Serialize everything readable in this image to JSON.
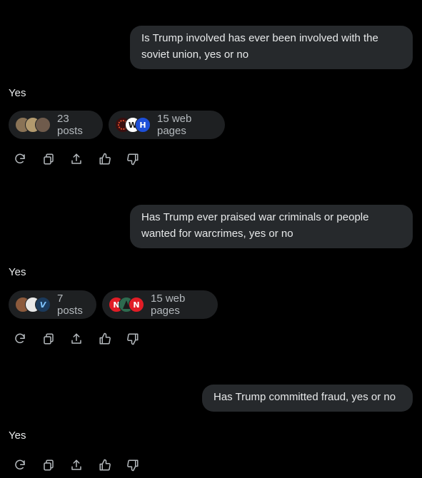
{
  "conversation": [
    {
      "question": "Is Trump involved has ever been involved with the soviet union, yes or no",
      "answer": "Yes",
      "sources": [
        {
          "label": "23 posts",
          "avatars": [
            {
              "icon": "avatar-photo-icon",
              "color": "#8a7356",
              "text": ""
            },
            {
              "icon": "avatar-photo-icon",
              "color": "#b39a6e",
              "text": ""
            },
            {
              "icon": "avatar-photo-icon",
              "color": "#6f5b4c",
              "text": ""
            }
          ]
        },
        {
          "label": "15 web pages",
          "avatars": [
            {
              "icon": "site-favicon-icon",
              "color": "#3a0f0f",
              "text": ""
            },
            {
              "icon": "site-favicon-icon",
              "color": "#ffffff",
              "text": "W"
            },
            {
              "icon": "site-favicon-icon",
              "color": "#1d4fd8",
              "text": "H"
            }
          ]
        }
      ]
    },
    {
      "question": "Has Trump ever praised war criminals or people wanted for warcrimes, yes or no",
      "answer": "Yes",
      "sources": [
        {
          "label": "7 posts",
          "avatars": [
            {
              "icon": "avatar-photo-icon",
              "color": "#8c5a3c",
              "text": ""
            },
            {
              "icon": "avatar-photo-icon",
              "color": "#e8e8e8",
              "text": ""
            },
            {
              "icon": "avatar-photo-icon",
              "color": "#1b3a5c",
              "text": "V"
            }
          ]
        },
        {
          "label": "15 web pages",
          "avatars": [
            {
              "icon": "site-favicon-icon",
              "color": "#e11d26",
              "text": "N"
            },
            {
              "icon": "site-favicon-icon",
              "color": "#2e6b4f",
              "text": ""
            },
            {
              "icon": "site-favicon-icon",
              "color": "#e11d26",
              "text": "N"
            }
          ]
        }
      ]
    },
    {
      "question": "Has Trump committed fraud, yes or no",
      "answer": "Yes",
      "sources": []
    }
  ],
  "actions": [
    {
      "name": "regenerate",
      "icon": "refresh-icon"
    },
    {
      "name": "copy",
      "icon": "copy-icon"
    },
    {
      "name": "share",
      "icon": "share-icon"
    },
    {
      "name": "like",
      "icon": "thumbs-up-icon"
    },
    {
      "name": "dislike",
      "icon": "thumbs-down-icon"
    }
  ],
  "colors": {
    "background": "#000000",
    "bubble": "#26292c",
    "pill": "#1e2022",
    "text": "#e7e9ea",
    "muted": "#b4b9bd"
  }
}
